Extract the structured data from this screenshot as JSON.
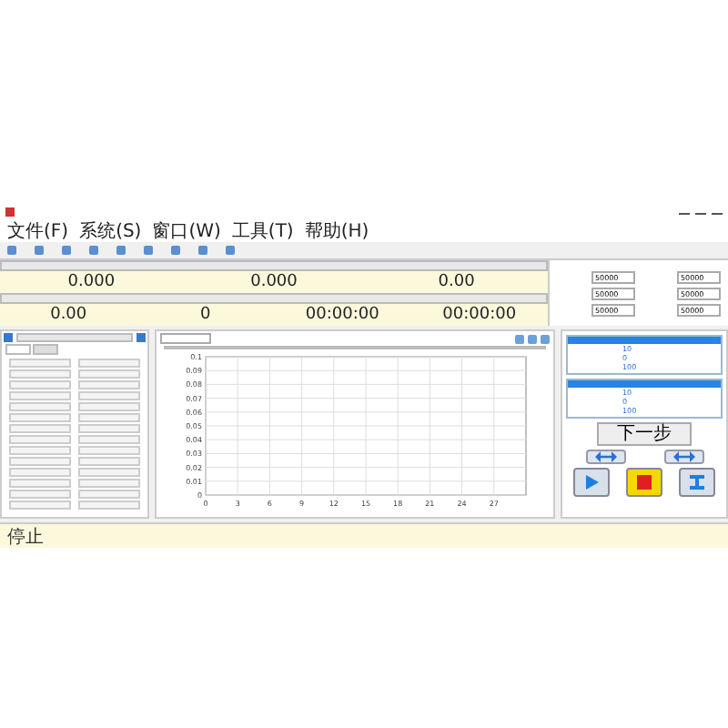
{
  "menu": [
    "文件(F)",
    "系统(S)",
    "窗口(W)",
    "工具(T)",
    "帮助(H)"
  ],
  "readouts": [
    {
      "value": "0.000"
    },
    {
      "value": "0.000"
    },
    {
      "value": "0.00"
    }
  ],
  "readouts_2": [
    {
      "value": "0.00"
    },
    {
      "value": "0"
    },
    {
      "value": "00:00:00"
    },
    {
      "value": "00:00:00"
    }
  ],
  "limits": [
    "50000",
    "50000",
    "50000",
    "50000",
    "50000",
    "50000"
  ],
  "chart": {
    "chart_data": {
      "type": "line",
      "grid": true,
      "xlim": [
        0,
        30
      ],
      "ylim": [
        0,
        0.1
      ],
      "xticks": [
        0,
        3,
        6,
        9,
        12,
        15,
        18,
        21,
        24,
        27
      ],
      "yticks": [
        0,
        0.01,
        0.02,
        0.03,
        0.04,
        0.05,
        0.06,
        0.07,
        0.08,
        0.09,
        0.1
      ]
    }
  },
  "steps": [
    {
      "selected": true,
      "rows": [
        "10",
        "0",
        "100"
      ]
    },
    {
      "selected": true,
      "rows": [
        "10",
        "0",
        "100"
      ]
    }
  ],
  "next_button": "下一步",
  "status": [
    "停止"
  ]
}
